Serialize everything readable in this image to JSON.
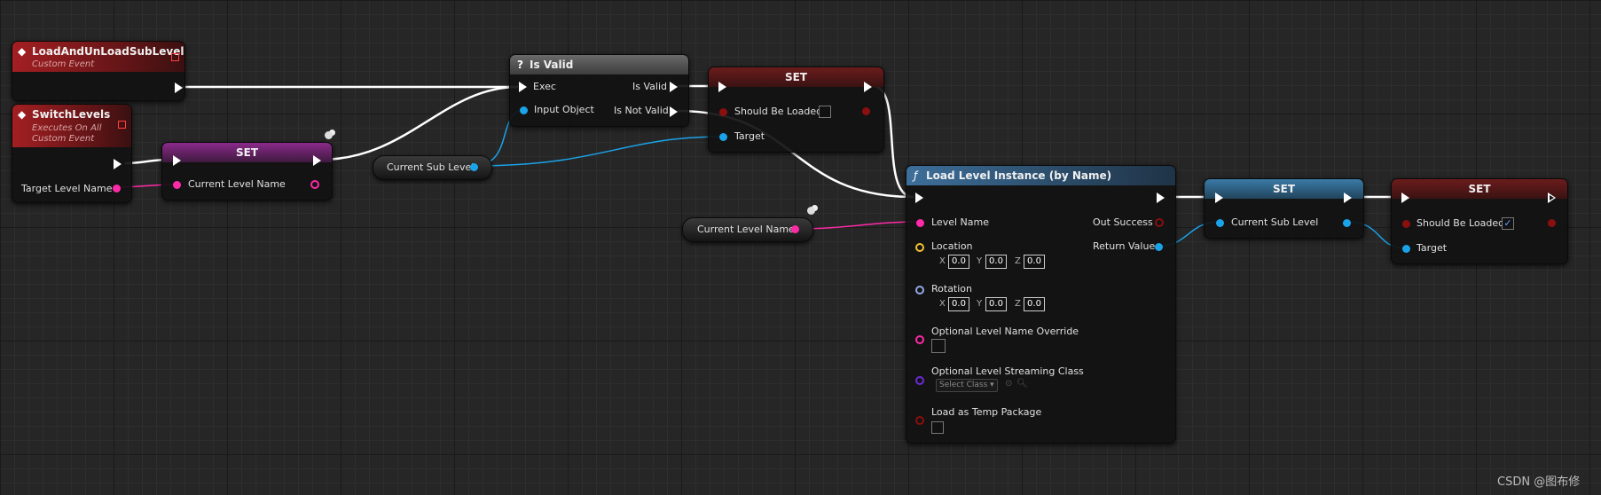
{
  "nodes": {
    "event1": {
      "title": "LoadAndUnLoadSubLevel",
      "subtitle": "Custom Event"
    },
    "event2": {
      "title": "SwitchLevels",
      "subtitle_line1": "Executes On All",
      "subtitle_line2": "Custom Event",
      "pin_label": "Target Level Name"
    },
    "set1": {
      "title": "SET",
      "pin_label": "Current Level Name"
    },
    "is_valid": {
      "title": "Is Valid",
      "icon": "?",
      "exec_label": "Exec",
      "input_label": "Input Object",
      "is_valid_label": "Is Valid",
      "is_not_valid_label": "Is Not Valid"
    },
    "set2": {
      "title": "SET",
      "should_label": "Should Be Loaded",
      "target_label": "Target"
    },
    "var_sub_level": {
      "label": "Current Sub Level"
    },
    "var_level_name": {
      "label": "Current Level Name"
    },
    "load_level": {
      "title": "Load Level Instance (by Name)",
      "icon": "ƒ",
      "level_name": "Level Name",
      "location": "Location",
      "rotation": "Rotation",
      "x": "X",
      "y": "Y",
      "z": "Z",
      "loc_x": "0.0",
      "loc_y": "0.0",
      "loc_z": "0.0",
      "rot_x": "0.0",
      "rot_y": "0.0",
      "rot_z": "0.0",
      "override": "Optional Level Name Override",
      "streaming_class": "Optional Level Streaming Class",
      "select_class": "Select Class",
      "temp_package": "Load as Temp Package",
      "out_success": "Out Success",
      "return_value": "Return Value"
    },
    "set3": {
      "title": "SET",
      "pin_label": "Current Sub Level"
    },
    "set4": {
      "title": "SET",
      "should_label": "Should Be Loaded",
      "target_label": "Target"
    }
  },
  "watermark": "CSDN @图布修",
  "colors": {
    "exec": "#ffffff",
    "name_pin": "#ff2aa8",
    "object_pin": "#1aa3e8",
    "vector_pin": "#f4c030",
    "rotator_pin": "#90a8e8",
    "class_pin": "#6a2ad8",
    "bool_pin": "#8a0f0f"
  }
}
